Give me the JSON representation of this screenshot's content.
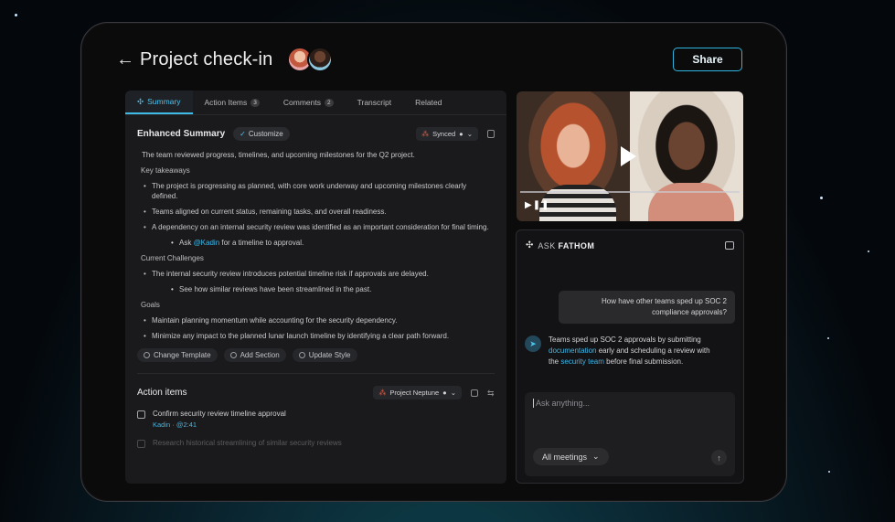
{
  "header": {
    "back_icon": "arrow-left-icon",
    "title": "Project check-in",
    "share_label": "Share"
  },
  "tabs": [
    {
      "label": "Summary",
      "count": ""
    },
    {
      "label": "Action Items",
      "count": "3"
    },
    {
      "label": "Comments",
      "count": "2"
    },
    {
      "label": "Transcript",
      "count": ""
    },
    {
      "label": "Related",
      "count": ""
    }
  ],
  "summary": {
    "title": "Enhanced Summary",
    "customize_label": "Customize",
    "synced_label": "Synced",
    "intro": "The team reviewed progress, timelines, and upcoming milestones for the Q2 project.",
    "key_takeaways_label": "Key takeaways",
    "takeaways": [
      "The project is progressing as planned, with core work underway and upcoming milestones clearly defined.",
      "Teams aligned on current status, remaining tasks, and overall readiness.",
      "A dependency on an internal security review was identified as an important consideration for final timing."
    ],
    "sub_ask_prefix": "Ask ",
    "sub_ask_mention": "@Kadin",
    "sub_ask_suffix": " for a timeline to approval.",
    "challenges_label": "Current Challenges",
    "challenge": "The internal security review introduces potential timeline risk if approvals are delayed.",
    "challenge_sub": "See how similar reviews have been streamlined in the past.",
    "goals_label": "Goals",
    "goals": [
      "Maintain planning momentum while accounting for the security dependency.",
      "Minimize any impact to the planned lunar launch timeline by identifying a clear path forward."
    ],
    "buttons": [
      "Change Template",
      "Add Section",
      "Update Style"
    ]
  },
  "action_items": {
    "title": "Action items",
    "project_label": "Project Neptune",
    "tasks": [
      {
        "text": "Confirm security review timeline approval",
        "meta": "Kadin · @2:41"
      },
      {
        "text": "Research historical streamlining of similar security reviews",
        "meta": ""
      }
    ]
  },
  "ask": {
    "title_prefix": "ASK ",
    "title_brand": "FATHOM",
    "question": "How have other teams sped up SOC 2 compliance approvals?",
    "answer_1": "Teams sped up SOC 2 approvals by submitting ",
    "answer_link_1": "documentation",
    "answer_2": " early and scheduling a review with the ",
    "answer_link_2": "security team",
    "answer_3": " before final submission.",
    "input_placeholder": "Ask anything...",
    "meetings_label": "All meetings"
  },
  "colors": {
    "accent": "#3db9e6",
    "background": "#0b0b0c",
    "panel": "#1a1a1c"
  }
}
